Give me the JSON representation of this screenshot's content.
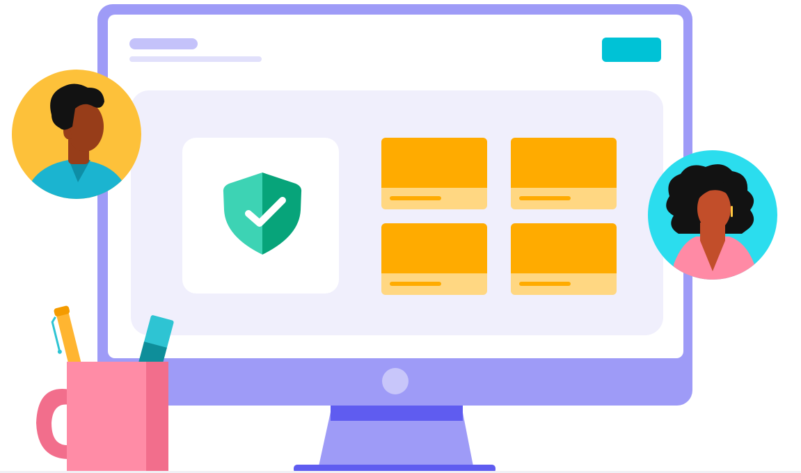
{
  "colors": {
    "monitor_frame": "#9E9BF7",
    "screen": "#FFFFFF",
    "topbar_pill": "#C4C2FA",
    "topbar_line": "#E1E0FB",
    "action_button": "#00C2D6",
    "content_panel": "#F0EFFC",
    "shield_card": "#FFFFFF",
    "shield_left": "#3DD3B4",
    "shield_right": "#07A47A",
    "tile_top": "#FFAB00",
    "tile_bottom": "#FFD782",
    "tile_line": "#FFAB00",
    "power_button": "#C8C6FA",
    "stand": "#9E9BF7",
    "stand_top": "#5F5CF0",
    "base": "#5F5CF0",
    "floor": "#F0F0F5",
    "avatar_man_bg": "#FDC13A",
    "avatar_woman_bg": "#2BDDEE",
    "skin_man": "#973D19",
    "skin_woman": "#C24E2A",
    "hair": "#121212",
    "shirt_man": "#1BB4D0",
    "shirt_woman": "#FF8AA5",
    "mug": "#FF8CA6",
    "mug_shade": "#F26E8C",
    "pen": "#FFB531",
    "pen_clip": "#2EC4D3",
    "marker_cap": "#2EC4D3",
    "marker_body": "#0E8E9A"
  },
  "icons": {
    "shield": "shield-check-icon",
    "avatar_left": "man-avatar-icon",
    "avatar_right": "woman-avatar-icon",
    "mug": "pen-holder-mug-icon"
  }
}
